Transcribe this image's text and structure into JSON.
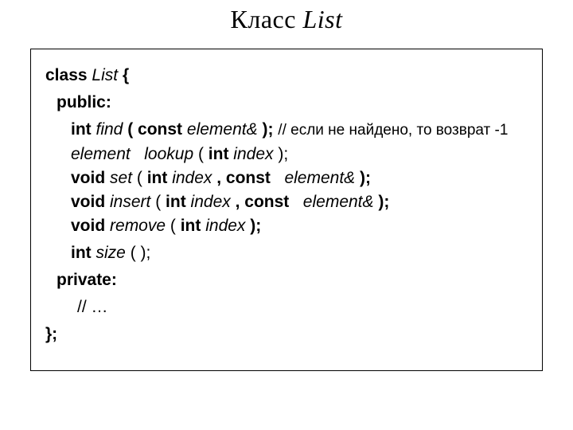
{
  "title": {
    "word1": "Класс",
    "word2": "List"
  },
  "code": {
    "class_kw": "class",
    "class_name": "List",
    "openbrace": "{",
    "public_kw": "public:",
    "private_kw": "private:",
    "closebrace": "};",
    "find": {
      "ret": "int",
      "name": "find",
      "open": "(",
      "const_kw": "const",
      "param_type": "element&",
      "close": "); ",
      "comment": "// если не найдено, то возврат -1"
    },
    "lookup": {
      "ret": "element",
      "name": "lookup",
      "open": "( ",
      "int_kw": "int",
      "param_name": "index",
      "close": " );"
    },
    "set": {
      "ret": "void",
      "name": "set",
      "open": "( ",
      "int_kw": "int",
      "index": "index",
      "comma": ", ",
      "const_kw": "const",
      "elem": "element&",
      "close": " );"
    },
    "insert": {
      "ret": "void",
      "name": "insert",
      "open": "( ",
      "int_kw": "int",
      "index": "index",
      "comma": ", ",
      "const_kw": "const",
      "elem": "element&",
      "close": " );"
    },
    "remove": {
      "ret": "void",
      "name": "remove",
      "open": "( ",
      "int_kw": "int",
      "index": "index",
      "close": " );"
    },
    "size": {
      "ret": "int",
      "name": "size",
      "args": "( );"
    },
    "private_body": "// …"
  }
}
